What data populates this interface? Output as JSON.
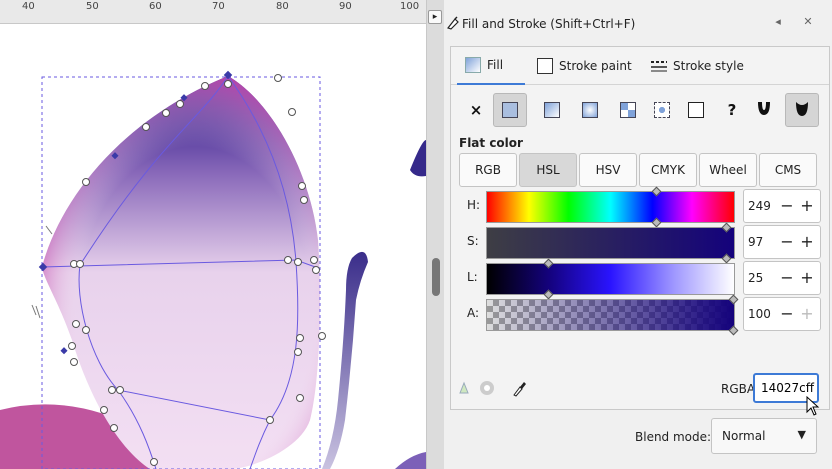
{
  "ruler": {
    "labels": [
      "40",
      "50",
      "60",
      "70",
      "80",
      "90",
      "100"
    ]
  },
  "dialog": {
    "title": "Fill and Stroke (Shift+Ctrl+F)",
    "tabs": [
      {
        "label": "Fill",
        "icon": "fill-swatch-icon",
        "active": true
      },
      {
        "label": "Stroke paint",
        "icon": "stroke-paint-icon",
        "active": false
      },
      {
        "label": "Stroke style",
        "icon": "stroke-style-icon",
        "active": false
      }
    ],
    "paint_types": [
      {
        "name": "no-paint",
        "glyph": "×"
      },
      {
        "name": "flat-color",
        "glyph": "",
        "selected": true
      },
      {
        "name": "linear-gradient",
        "glyph": ""
      },
      {
        "name": "radial-gradient",
        "glyph": ""
      },
      {
        "name": "pattern",
        "glyph": ""
      },
      {
        "name": "swatch",
        "glyph": ""
      },
      {
        "name": "mesh",
        "glyph": ""
      },
      {
        "name": "unset",
        "glyph": "?"
      },
      {
        "name": "fill-rule-evenodd",
        "glyph": ""
      },
      {
        "name": "fill-rule-nonzero",
        "glyph": ""
      }
    ],
    "flat_color_label": "Flat color",
    "color_modes": [
      {
        "label": "RGB",
        "selected": false
      },
      {
        "label": "HSL",
        "selected": true
      },
      {
        "label": "HSV",
        "selected": false
      },
      {
        "label": "CMYK",
        "selected": false
      },
      {
        "label": "Wheel",
        "selected": false
      },
      {
        "label": "CMS",
        "selected": false
      }
    ],
    "sliders": [
      {
        "label": "H:",
        "value": "249",
        "fraction": 0.69
      },
      {
        "label": "S:",
        "value": "97",
        "fraction": 0.97
      },
      {
        "label": "L:",
        "value": "25",
        "fraction": 0.25
      },
      {
        "label": "A:",
        "value": "100",
        "fraction": 1.0
      }
    ],
    "rgba_label": "RGBA:",
    "rgba_value": "14027cff",
    "blend_label": "Blend mode:",
    "blend_value": "Normal"
  },
  "colors": {
    "accent": "#3d7ad6",
    "current": "#14027c"
  }
}
